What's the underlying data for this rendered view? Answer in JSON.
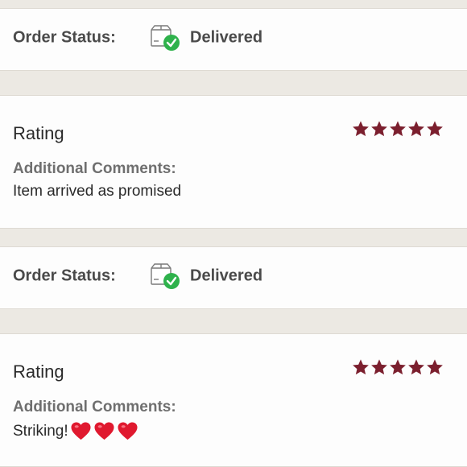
{
  "orders": [
    {
      "status_label": "Order Status:",
      "status_value": "Delivered",
      "status_icon": "box-delivered-check-icon",
      "rating_title": "Rating",
      "stars": 5,
      "comments_label": "Additional Comments:",
      "comment": "Item arrived as promised",
      "emoji": ""
    },
    {
      "status_label": "Order Status:",
      "status_value": "Delivered",
      "status_icon": "box-delivered-check-icon",
      "rating_title": "Rating",
      "stars": 5,
      "comments_label": "Additional Comments:",
      "comment": "Striking!",
      "emoji": "heart-icon x3"
    }
  ],
  "colors": {
    "star": "#7b1f2e",
    "check": "#2fb24c",
    "heart": "#e0192f",
    "background": "#ece9e3",
    "card": "#fdfdfd"
  }
}
